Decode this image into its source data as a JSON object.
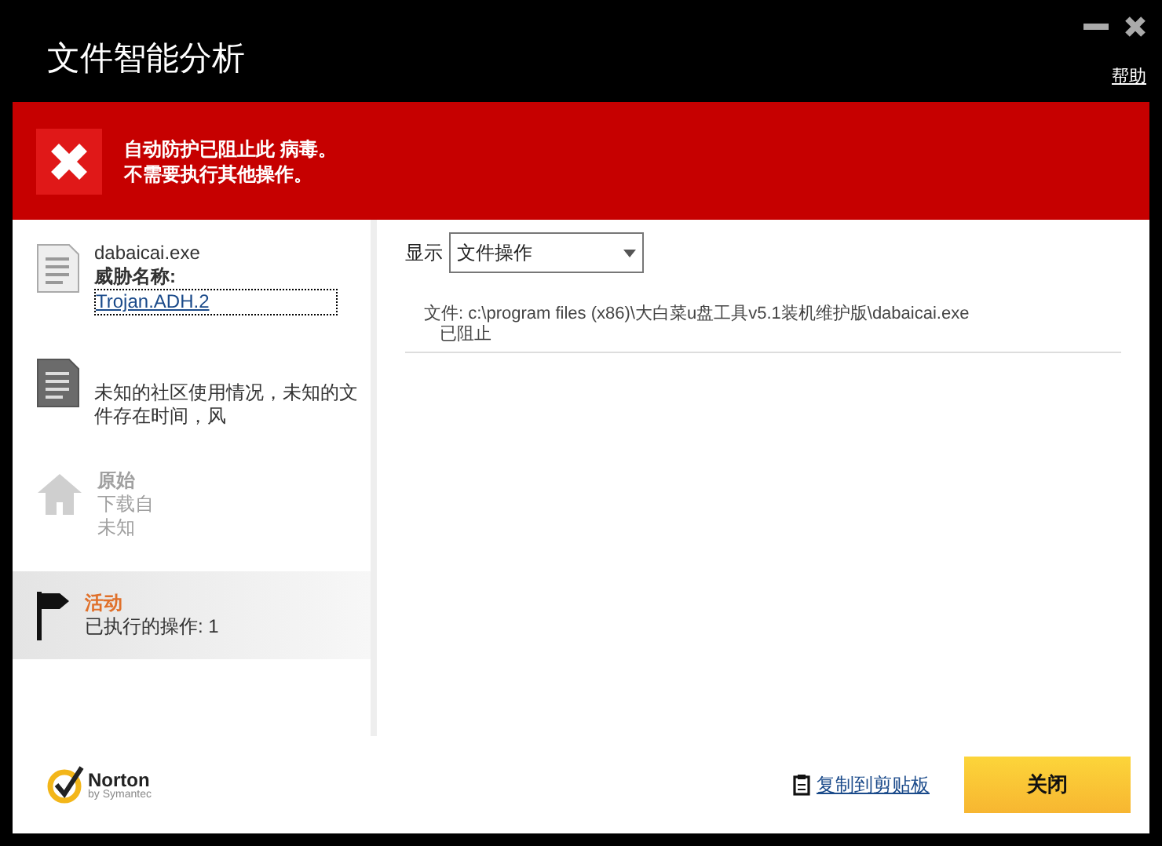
{
  "window": {
    "title": "文件智能分析",
    "help": "帮助"
  },
  "alert": {
    "lines": [
      "自动防护已阻止此 病毒。",
      "不需要执行其他操作。"
    ]
  },
  "sidebar": {
    "items": [
      {
        "kind": "file",
        "name": "dabaicai.exe",
        "label": "威胁名称:",
        "link": "Trojan.ADH.2",
        "selected": false,
        "disabled": false
      },
      {
        "kind": "reputation",
        "lines": [
          "未知的社区使用情况，未知的文",
          "件存在时间，风"
        ],
        "selected": false,
        "disabled": false
      },
      {
        "kind": "origin",
        "title": "原始",
        "lines": [
          "下载自",
          "未知"
        ],
        "selected": false,
        "disabled": true
      },
      {
        "kind": "activity",
        "title": "活动",
        "lines": [
          "已执行的操作: 1"
        ],
        "selected": true,
        "disabled": false
      }
    ]
  },
  "panel": {
    "show_label": "显示",
    "filter": {
      "value": "文件操作"
    },
    "entries": [
      {
        "file": "文件: c:\\program files (x86)\\大白菜u盘工具v5.1装机维护版\\dabaicai.exe",
        "status": "已阻止"
      }
    ]
  },
  "footer": {
    "brand": "Norton",
    "brand_sub": "by Symantec",
    "copy_link": "复制到剪贴板",
    "close_button": "关闭"
  }
}
